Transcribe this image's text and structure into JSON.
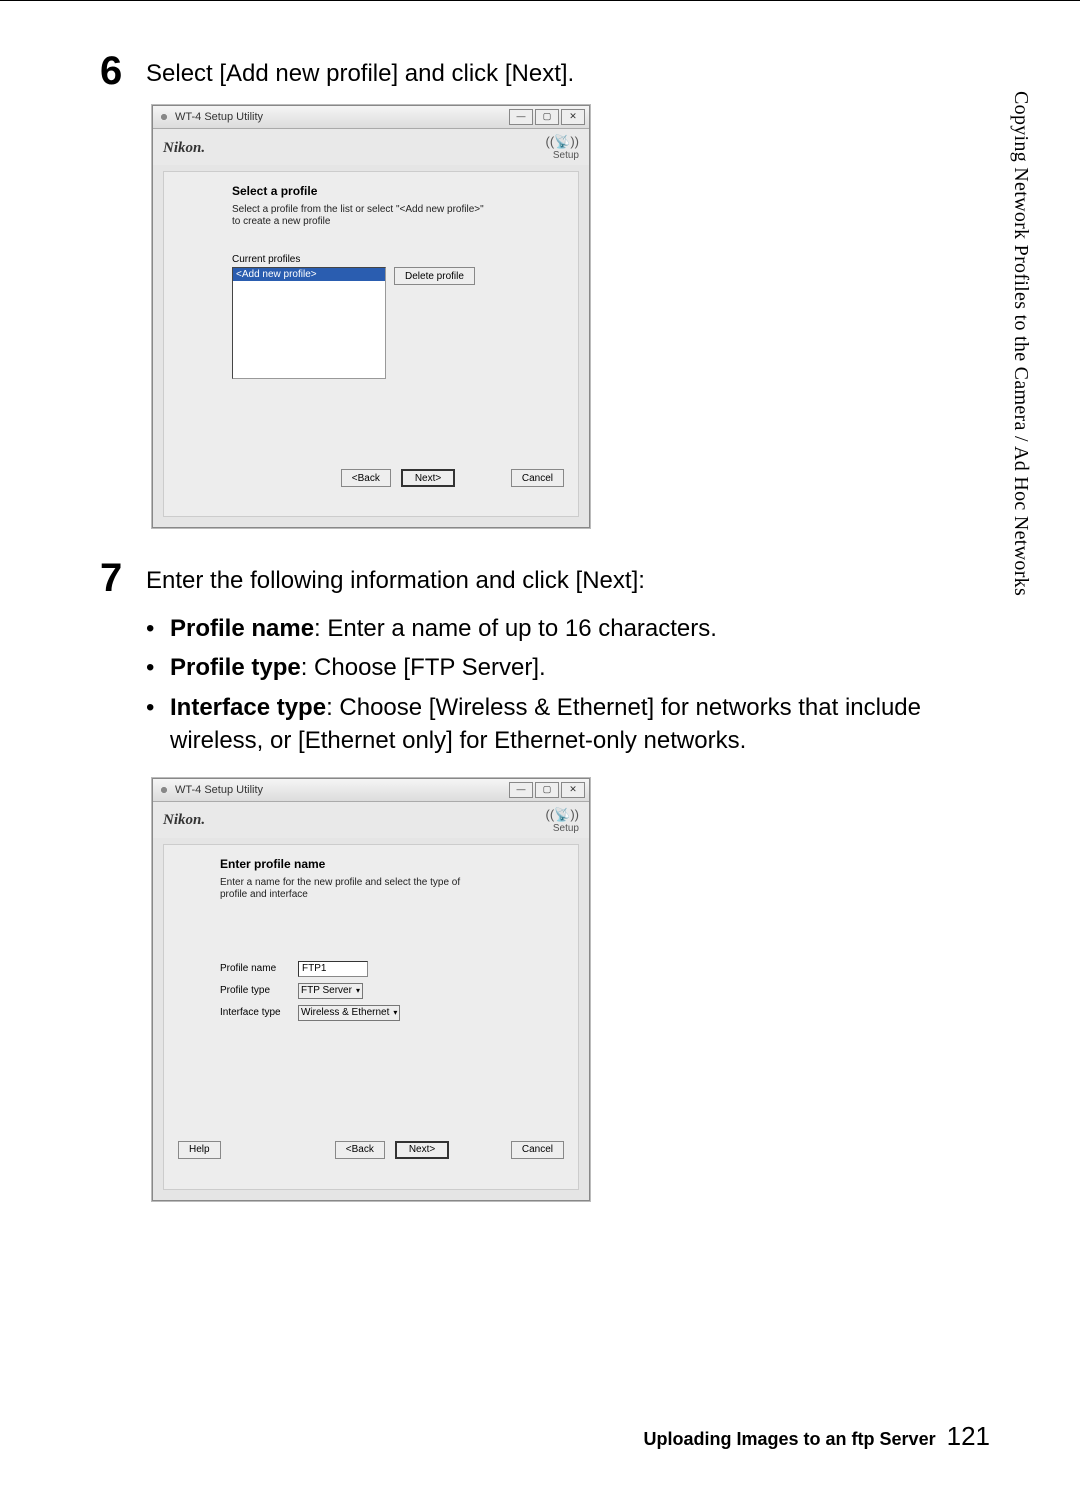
{
  "side_label": "Copying Network Profiles to the Camera / Ad Hoc Networks",
  "step6": {
    "num": "6",
    "text": "Select [Add new profile] and click [Next]."
  },
  "step7": {
    "num": "7",
    "text": "Enter the following information and click [Next]:",
    "bullets": [
      {
        "label": "Profile name",
        "text": ": Enter a name of up to 16 characters."
      },
      {
        "label": "Profile type",
        "text": ": Choose [FTP Server]."
      },
      {
        "label": "Interface type",
        "text": ": Choose [Wireless & Ethernet] for networks that include wireless, or [Ethernet only] for Ethernet-only networks."
      }
    ]
  },
  "dialog_common": {
    "title": "WT-4 Setup Utility",
    "brand": "Nikon.",
    "setup_label": "Setup",
    "buttons": {
      "back": "<Back",
      "next": "Next>",
      "cancel": "Cancel",
      "help": "Help",
      "delete": "Delete profile"
    }
  },
  "dialog1": {
    "section_title": "Select a profile",
    "section_desc": "Select a profile from the list or select \"<Add new profile>\" to create a new profile",
    "current_profiles_label": "Current profiles",
    "selected_item": "<Add new profile>"
  },
  "dialog2": {
    "section_title": "Enter profile name",
    "section_desc": "Enter a name for the new profile and select the type of profile and interface",
    "fields": {
      "name_label": "Profile name",
      "name_value": "FTP1",
      "type_label": "Profile type",
      "type_value": "FTP Server",
      "iface_label": "Interface type",
      "iface_value": "Wireless & Ethernet"
    }
  },
  "footer": {
    "title": "Uploading Images to an ftp Server",
    "page": "121"
  }
}
